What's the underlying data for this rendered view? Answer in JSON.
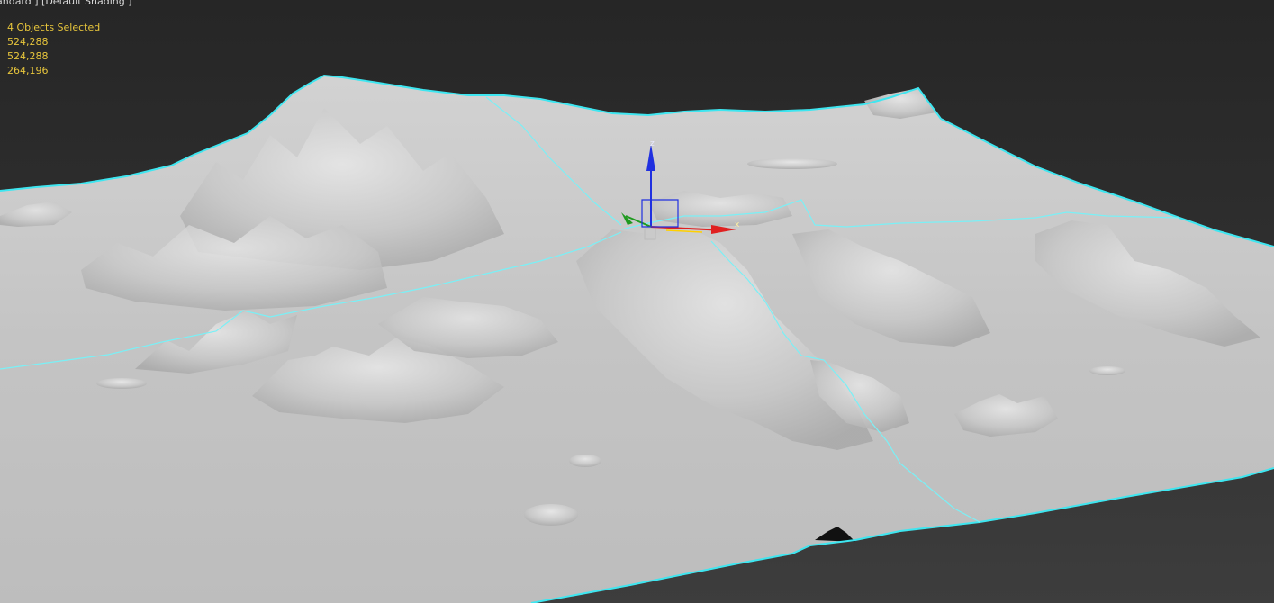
{
  "viewport": {
    "label_text": "andard ] [Default Shading ]",
    "stats": {
      "objects_selected": "4 Objects Selected",
      "polys": "524,288",
      "tris": "524,288",
      "verts": "264,196"
    }
  },
  "gizmo": {
    "axis_z": "z",
    "axis_x": "x",
    "colors": {
      "x": "#e02020",
      "y": "#1f9a1f",
      "z": "#2030e0"
    }
  },
  "colors": {
    "selection_edge": "#3ee6f0",
    "terrain": "#c9c9c9",
    "background": "#2e2e2e",
    "stats_text": "#e8c63c"
  }
}
